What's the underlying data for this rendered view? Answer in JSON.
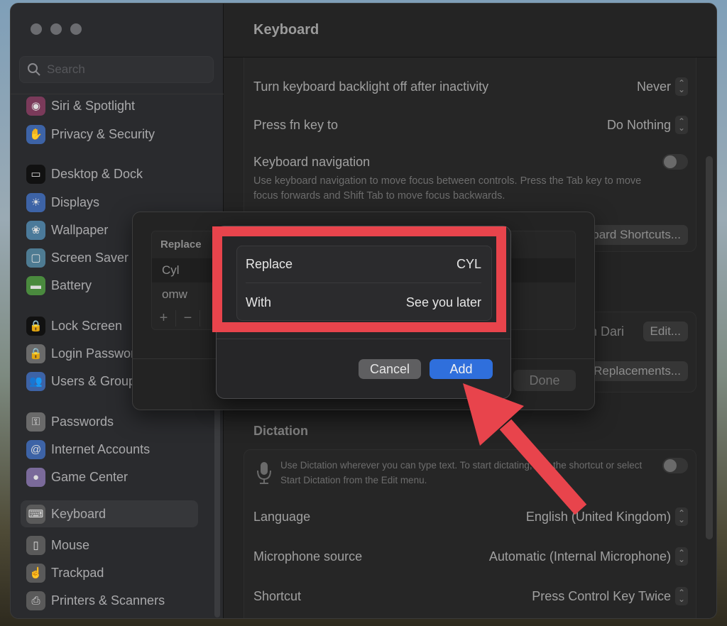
{
  "window": {
    "title": "Keyboard"
  },
  "sidebar": {
    "search_placeholder": "Search",
    "items": [
      {
        "label": "Siri & Spotlight",
        "icon": "siri-icon",
        "color": "#7a3a5a"
      },
      {
        "label": "Privacy & Security",
        "icon": "hand-icon",
        "color": "#3d63a6"
      },
      {
        "label": "Desktop & Dock",
        "icon": "dock-icon",
        "color": "#111111"
      },
      {
        "label": "Displays",
        "icon": "sun-icon",
        "color": "#3d63a6"
      },
      {
        "label": "Wallpaper",
        "icon": "flower-icon",
        "color": "#4b7a9a"
      },
      {
        "label": "Screen Saver",
        "icon": "screensaver-icon",
        "color": "#4e7b92"
      },
      {
        "label": "Battery",
        "icon": "battery-icon",
        "color": "#4a8a3e"
      },
      {
        "label": "Lock Screen",
        "icon": "lock-screen-icon",
        "color": "#111111"
      },
      {
        "label": "Login Password",
        "icon": "lock-icon",
        "color": "#6a6a6a"
      },
      {
        "label": "Users & Groups",
        "icon": "users-icon",
        "color": "#3d63a6"
      },
      {
        "label": "Passwords",
        "icon": "key-icon",
        "color": "#6a6a6a"
      },
      {
        "label": "Internet Accounts",
        "icon": "at-icon",
        "color": "#3d63a6"
      },
      {
        "label": "Game Center",
        "icon": "game-center-icon",
        "color": "#7a6a9a"
      },
      {
        "label": "Keyboard",
        "icon": "keyboard-icon",
        "color": "#5a5a5a",
        "active": true
      },
      {
        "label": "Mouse",
        "icon": "mouse-icon",
        "color": "#5a5a5a"
      },
      {
        "label": "Trackpad",
        "icon": "trackpad-icon",
        "color": "#5a5a5a"
      },
      {
        "label": "Printers & Scanners",
        "icon": "printer-icon",
        "color": "#5a5a5a"
      }
    ]
  },
  "main": {
    "backlight_label": "Turn keyboard backlight off after inactivity",
    "backlight_value": "Never",
    "fn_label": "Press fn key to",
    "fn_value": "Do Nothing",
    "nav_label": "Keyboard navigation",
    "nav_desc": "Use keyboard navigation to move focus between controls. Press the Tab key to move focus forwards and Shift Tab to move focus backwards.",
    "shortcuts_button": "Keyboard Shortcuts...",
    "input_source_partial": "Persian Dari",
    "edit_button": "Edit...",
    "text_replacements_button": "Text Replacements...",
    "dictation_title": "Dictation",
    "dictation_desc": "Use Dictation wherever you can type text. To start dictating, use the shortcut or select Start Dictation from the Edit menu.",
    "language_label": "Language",
    "language_value": "English (United Kingdom)",
    "mic_label": "Microphone source",
    "mic_value": "Automatic (Internal Microphone)",
    "shortcut_label": "Shortcut",
    "shortcut_value": "Press Control Key Twice"
  },
  "replacements_sheet": {
    "column_header": "Replace",
    "rows": [
      "Cyl",
      "omw"
    ],
    "add_symbol": "+",
    "remove_symbol": "−",
    "done_button": "Done"
  },
  "add_dialog": {
    "replace_label": "Replace",
    "replace_value": "CYL",
    "with_label": "With",
    "with_value": "See you later",
    "cancel_button": "Cancel",
    "add_button": "Add"
  },
  "annotation": {
    "highlight_color": "#e8444c"
  }
}
